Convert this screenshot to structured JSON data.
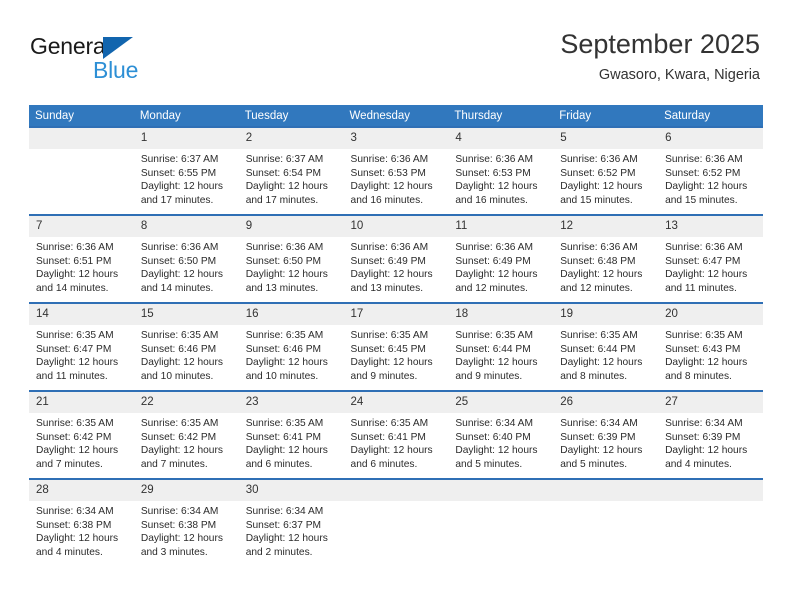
{
  "logo": {
    "word_one": "General",
    "word_two": "Blue",
    "triangle_icon": "triangle-icon",
    "accent_dark_blue": "#1265ae",
    "accent_light_blue": "#2d8fd5"
  },
  "header": {
    "title": "September 2025",
    "subtitle": "Gwasoro, Kwara, Nigeria"
  },
  "theme": {
    "header_blue": "#3178be",
    "row_divider_blue": "#2f6fb5",
    "daynum_background": "#efefef",
    "text_color": "#2b2b2b"
  },
  "calendar": {
    "weekday_headers": [
      "Sunday",
      "Monday",
      "Tuesday",
      "Wednesday",
      "Thursday",
      "Friday",
      "Saturday"
    ],
    "weeks": [
      [
        {
          "day": "",
          "lines": []
        },
        {
          "day": "1",
          "lines": [
            "Sunrise: 6:37 AM",
            "Sunset: 6:55 PM",
            "Daylight: 12 hours",
            "and 17 minutes."
          ]
        },
        {
          "day": "2",
          "lines": [
            "Sunrise: 6:37 AM",
            "Sunset: 6:54 PM",
            "Daylight: 12 hours",
            "and 17 minutes."
          ]
        },
        {
          "day": "3",
          "lines": [
            "Sunrise: 6:36 AM",
            "Sunset: 6:53 PM",
            "Daylight: 12 hours",
            "and 16 minutes."
          ]
        },
        {
          "day": "4",
          "lines": [
            "Sunrise: 6:36 AM",
            "Sunset: 6:53 PM",
            "Daylight: 12 hours",
            "and 16 minutes."
          ]
        },
        {
          "day": "5",
          "lines": [
            "Sunrise: 6:36 AM",
            "Sunset: 6:52 PM",
            "Daylight: 12 hours",
            "and 15 minutes."
          ]
        },
        {
          "day": "6",
          "lines": [
            "Sunrise: 6:36 AM",
            "Sunset: 6:52 PM",
            "Daylight: 12 hours",
            "and 15 minutes."
          ]
        }
      ],
      [
        {
          "day": "7",
          "lines": [
            "Sunrise: 6:36 AM",
            "Sunset: 6:51 PM",
            "Daylight: 12 hours",
            "and 14 minutes."
          ]
        },
        {
          "day": "8",
          "lines": [
            "Sunrise: 6:36 AM",
            "Sunset: 6:50 PM",
            "Daylight: 12 hours",
            "and 14 minutes."
          ]
        },
        {
          "day": "9",
          "lines": [
            "Sunrise: 6:36 AM",
            "Sunset: 6:50 PM",
            "Daylight: 12 hours",
            "and 13 minutes."
          ]
        },
        {
          "day": "10",
          "lines": [
            "Sunrise: 6:36 AM",
            "Sunset: 6:49 PM",
            "Daylight: 12 hours",
            "and 13 minutes."
          ]
        },
        {
          "day": "11",
          "lines": [
            "Sunrise: 6:36 AM",
            "Sunset: 6:49 PM",
            "Daylight: 12 hours",
            "and 12 minutes."
          ]
        },
        {
          "day": "12",
          "lines": [
            "Sunrise: 6:36 AM",
            "Sunset: 6:48 PM",
            "Daylight: 12 hours",
            "and 12 minutes."
          ]
        },
        {
          "day": "13",
          "lines": [
            "Sunrise: 6:36 AM",
            "Sunset: 6:47 PM",
            "Daylight: 12 hours",
            "and 11 minutes."
          ]
        }
      ],
      [
        {
          "day": "14",
          "lines": [
            "Sunrise: 6:35 AM",
            "Sunset: 6:47 PM",
            "Daylight: 12 hours",
            "and 11 minutes."
          ]
        },
        {
          "day": "15",
          "lines": [
            "Sunrise: 6:35 AM",
            "Sunset: 6:46 PM",
            "Daylight: 12 hours",
            "and 10 minutes."
          ]
        },
        {
          "day": "16",
          "lines": [
            "Sunrise: 6:35 AM",
            "Sunset: 6:46 PM",
            "Daylight: 12 hours",
            "and 10 minutes."
          ]
        },
        {
          "day": "17",
          "lines": [
            "Sunrise: 6:35 AM",
            "Sunset: 6:45 PM",
            "Daylight: 12 hours",
            "and 9 minutes."
          ]
        },
        {
          "day": "18",
          "lines": [
            "Sunrise: 6:35 AM",
            "Sunset: 6:44 PM",
            "Daylight: 12 hours",
            "and 9 minutes."
          ]
        },
        {
          "day": "19",
          "lines": [
            "Sunrise: 6:35 AM",
            "Sunset: 6:44 PM",
            "Daylight: 12 hours",
            "and 8 minutes."
          ]
        },
        {
          "day": "20",
          "lines": [
            "Sunrise: 6:35 AM",
            "Sunset: 6:43 PM",
            "Daylight: 12 hours",
            "and 8 minutes."
          ]
        }
      ],
      [
        {
          "day": "21",
          "lines": [
            "Sunrise: 6:35 AM",
            "Sunset: 6:42 PM",
            "Daylight: 12 hours",
            "and 7 minutes."
          ]
        },
        {
          "day": "22",
          "lines": [
            "Sunrise: 6:35 AM",
            "Sunset: 6:42 PM",
            "Daylight: 12 hours",
            "and 7 minutes."
          ]
        },
        {
          "day": "23",
          "lines": [
            "Sunrise: 6:35 AM",
            "Sunset: 6:41 PM",
            "Daylight: 12 hours",
            "and 6 minutes."
          ]
        },
        {
          "day": "24",
          "lines": [
            "Sunrise: 6:35 AM",
            "Sunset: 6:41 PM",
            "Daylight: 12 hours",
            "and 6 minutes."
          ]
        },
        {
          "day": "25",
          "lines": [
            "Sunrise: 6:34 AM",
            "Sunset: 6:40 PM",
            "Daylight: 12 hours",
            "and 5 minutes."
          ]
        },
        {
          "day": "26",
          "lines": [
            "Sunrise: 6:34 AM",
            "Sunset: 6:39 PM",
            "Daylight: 12 hours",
            "and 5 minutes."
          ]
        },
        {
          "day": "27",
          "lines": [
            "Sunrise: 6:34 AM",
            "Sunset: 6:39 PM",
            "Daylight: 12 hours",
            "and 4 minutes."
          ]
        }
      ],
      [
        {
          "day": "28",
          "lines": [
            "Sunrise: 6:34 AM",
            "Sunset: 6:38 PM",
            "Daylight: 12 hours",
            "and 4 minutes."
          ]
        },
        {
          "day": "29",
          "lines": [
            "Sunrise: 6:34 AM",
            "Sunset: 6:38 PM",
            "Daylight: 12 hours",
            "and 3 minutes."
          ]
        },
        {
          "day": "30",
          "lines": [
            "Sunrise: 6:34 AM",
            "Sunset: 6:37 PM",
            "Daylight: 12 hours",
            "and 2 minutes."
          ]
        },
        {
          "day": "",
          "lines": []
        },
        {
          "day": "",
          "lines": []
        },
        {
          "day": "",
          "lines": []
        },
        {
          "day": "",
          "lines": []
        }
      ]
    ]
  }
}
